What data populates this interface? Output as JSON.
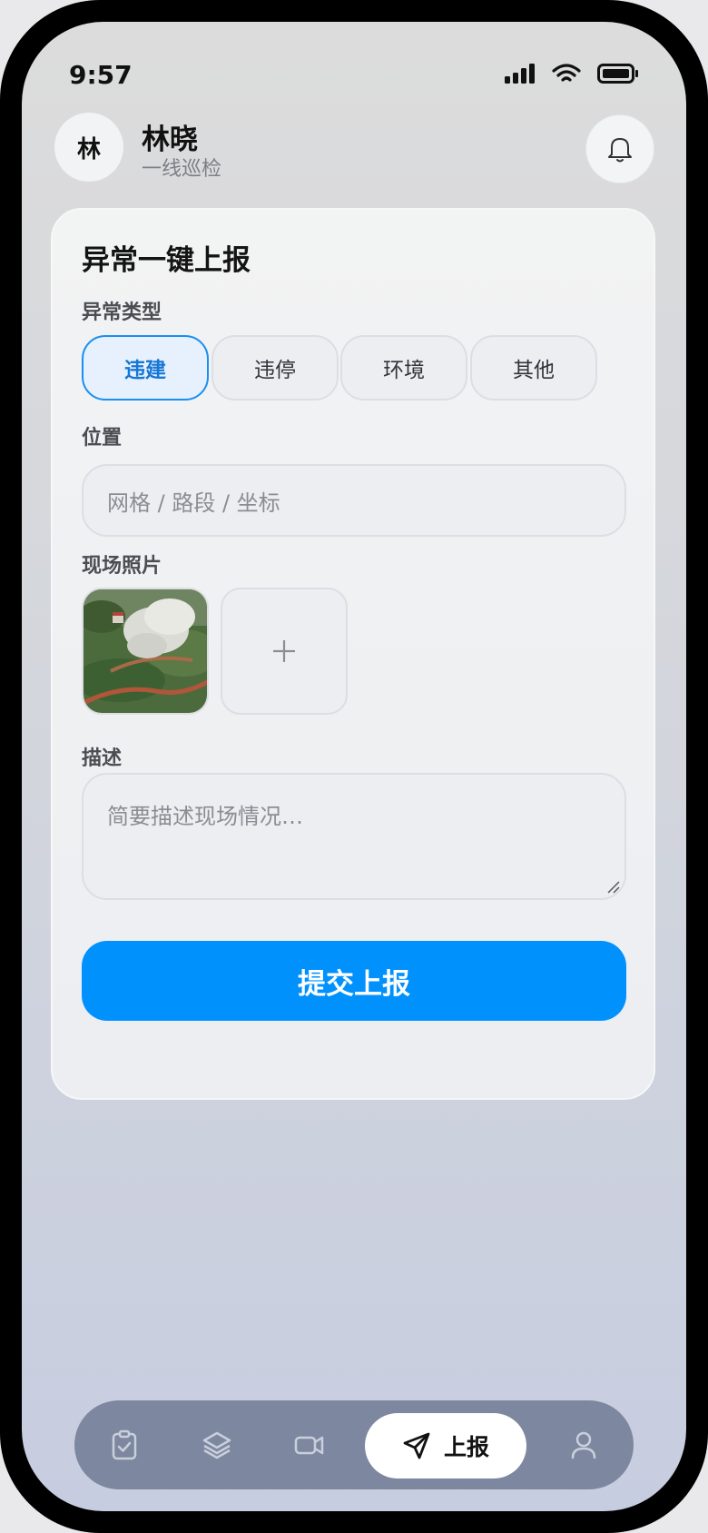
{
  "status_bar": {
    "time": "9:57"
  },
  "header": {
    "avatar_text": "林",
    "user_name": "林晓",
    "user_role": "一线巡检"
  },
  "form": {
    "title": "异常一键上报",
    "type_label": "异常类型",
    "types": [
      "违建",
      "违停",
      "环境",
      "其他"
    ],
    "selected_type": "违建",
    "location_label": "位置",
    "location_placeholder": "网格 / 路段 / 坐标",
    "photo_label": "现场照片",
    "add_photo_symbol": "+",
    "description_label": "描述",
    "description_placeholder": "简要描述现场情况…",
    "submit_label": "提交上报"
  },
  "bottom_nav": {
    "items": [
      {
        "icon": "clipboard-check-icon"
      },
      {
        "icon": "layers-icon"
      },
      {
        "icon": "video-camera-icon"
      },
      {
        "icon": "send-icon",
        "label": "上报",
        "active": true
      },
      {
        "icon": "user-icon"
      }
    ]
  },
  "colors": {
    "accent": "#0191fd",
    "chip_active_border": "#1b8ef1",
    "nav_bg": "#7d879f"
  }
}
